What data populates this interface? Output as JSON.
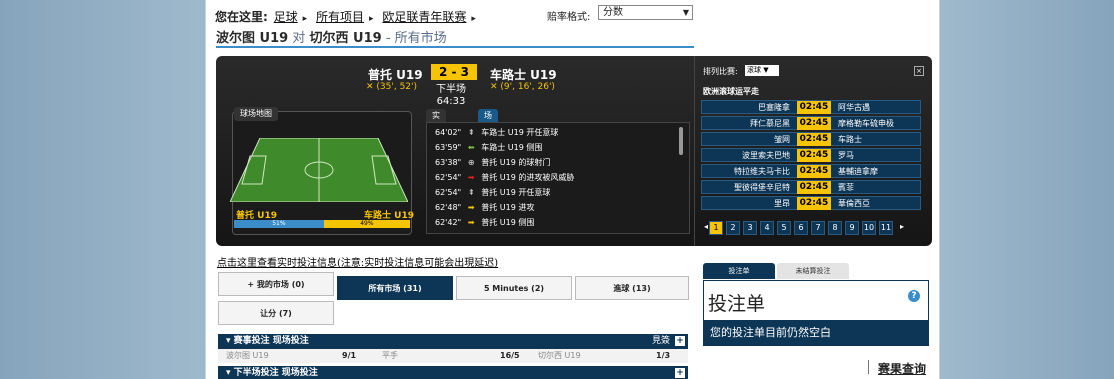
{
  "breadcrumb": {
    "prefix": "您在这里:",
    "items": [
      "足球",
      "所有项目",
      "欧足联青年联赛"
    ]
  },
  "odds_format": {
    "label": "赔率格式:",
    "value": "分数"
  },
  "page_title": {
    "home": "波尔图 U19",
    "vs": "对",
    "away": "切尔西 U19",
    "suffix": "- 所有市场"
  },
  "match": {
    "home": "普托 U19",
    "away": "车路士 U19",
    "score": "2 - 3",
    "period": "下半场",
    "clock": "64:33",
    "home_goals": "(35', 52')",
    "away_goals": "(9', 16', 26')"
  },
  "pitch_map": {
    "title": "球场地图",
    "home": "普托 U19",
    "away": "车路士 U19",
    "home_pct": "51%",
    "away_pct": "49%",
    "home_share": 0.51
  },
  "feed": {
    "tabs": [
      "实况解说",
      "场边统计"
    ],
    "events": [
      {
        "time": "64'02\"",
        "icon": "player-icon",
        "text": "车路士 U19 开任意球",
        "color": "#ddd"
      },
      {
        "time": "63'59\"",
        "icon": "arrow-left-icon",
        "text": "车路士 U19 侧围",
        "color": "#7ec24a"
      },
      {
        "time": "63'38\"",
        "icon": "target-icon",
        "text": "普托 U19 的球射门",
        "color": "#ddd"
      },
      {
        "time": "62'54\"",
        "icon": "arrow-right-icon",
        "text": "普托 U19 的进攻被风威胁",
        "color": "#e02020"
      },
      {
        "time": "62'54\"",
        "icon": "player-icon",
        "text": "普托 U19 开任意球",
        "color": "#ddd"
      },
      {
        "time": "62'48\"",
        "icon": "arrow-right-icon",
        "text": "普托 U19 进攻",
        "color": "#f6c400"
      },
      {
        "time": "62'42\"",
        "icon": "arrow-right-icon",
        "text": "普托 U19 侧围",
        "color": "#f6c400"
      }
    ]
  },
  "live_panel": {
    "sort_label": "排列比赛:",
    "sort_value": "滚球",
    "header": "欧洲滚球运平走",
    "rows": [
      {
        "home": "巴塞隆拿",
        "clock": "02:45",
        "away": "阿华古遇"
      },
      {
        "home": "拜仁慕尼黑",
        "clock": "02:45",
        "away": "摩格勒车硫申极"
      },
      {
        "home": "皱网",
        "clock": "02:45",
        "away": "车路士"
      },
      {
        "home": "波里索夫巴地",
        "clock": "02:45",
        "away": "罗马"
      },
      {
        "home": "特拉维夫马卡比",
        "clock": "02:45",
        "away": "基輔迪拿摩"
      },
      {
        "home": "聖彼得堡辛尼特",
        "clock": "02:45",
        "away": "賓菲"
      },
      {
        "home": "里昂",
        "clock": "02:45",
        "away": "華倫西亞"
      }
    ],
    "pages": [
      "1",
      "2",
      "3",
      "4",
      "5",
      "6",
      "7",
      "8",
      "9",
      "10",
      "11"
    ]
  },
  "live_link": "点击这里查看实时投注信息(注意:实时投注信息可能会出現延迟)",
  "market_tabs": [
    "+ 我的市场 (0)",
    "所有市场 (31)",
    "5 Minutes (2)",
    "進球 (13)",
    "让分 (7)"
  ],
  "sections": [
    {
      "title": "▾ 赛事投注 现场投注",
      "show": "見簽",
      "odds": [
        {
          "team": "波尔图 U19",
          "price": "9/1"
        },
        {
          "team": "平手",
          "price": "16/5"
        },
        {
          "team": "切尔西 U19",
          "price": "1/3"
        }
      ]
    },
    {
      "title": "▾ 下半场投注 现场投注"
    }
  ],
  "betslip": {
    "tabs": [
      "投注单",
      "未结算投注"
    ],
    "title": "投注单",
    "empty": "您的投注单目前仍然空白",
    "help": "?"
  },
  "check_link": "赛果查询",
  "colors": {
    "accent": "#f6c400",
    "navy": "#0c3556",
    "blue": "#3a8dc8"
  }
}
